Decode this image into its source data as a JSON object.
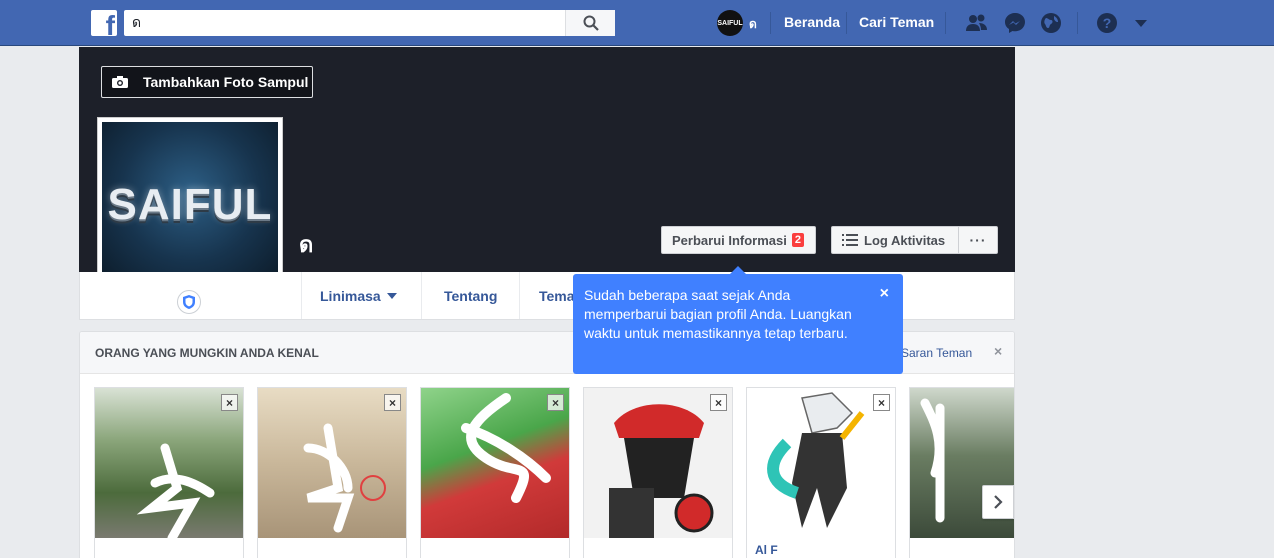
{
  "topbar": {
    "logo": "f",
    "search_value": "ด",
    "user_avatar_text": "SAIFUL",
    "user_name": "ด",
    "links": [
      "Beranda",
      "Cari Teman"
    ]
  },
  "cover": {
    "add_cover_label": "Tambahkan Foto Sampul",
    "profile_logo_text": "SAIFUL",
    "profile_name": "ด",
    "update_info_label": "Perbarui Informasi",
    "update_info_badge": "2",
    "activity_log_label": "Log Aktivitas",
    "more_label": "···"
  },
  "tabs": [
    "Linimasa",
    "Tentang",
    "Tema"
  ],
  "tooltip": {
    "text": "Sudah beberapa saat sejak Anda memperbarui bagian profil Anda. Luangkan waktu untuk memastikannya tetap terbaru.",
    "close": "×"
  },
  "pymk": {
    "title": "ORANG YANG MUNGKIN ANDA KENAL",
    "see_all": "Saran Teman",
    "close": "×",
    "cards": [
      {
        "name": "",
        "bg": "#5b7a4a"
      },
      {
        "name": "",
        "bg": "#c9b79a"
      },
      {
        "name": "",
        "bg": "#6fb86a"
      },
      {
        "name": "",
        "bg": "#e7e7e7"
      },
      {
        "name": "Al F",
        "bg": "#ffffff"
      },
      {
        "name": "",
        "bg": "#4c5a4c"
      }
    ]
  },
  "colors": {
    "brand": "#4267b2",
    "tooltip": "#4080ff",
    "badge": "#fa3e3e",
    "link": "#365899"
  }
}
